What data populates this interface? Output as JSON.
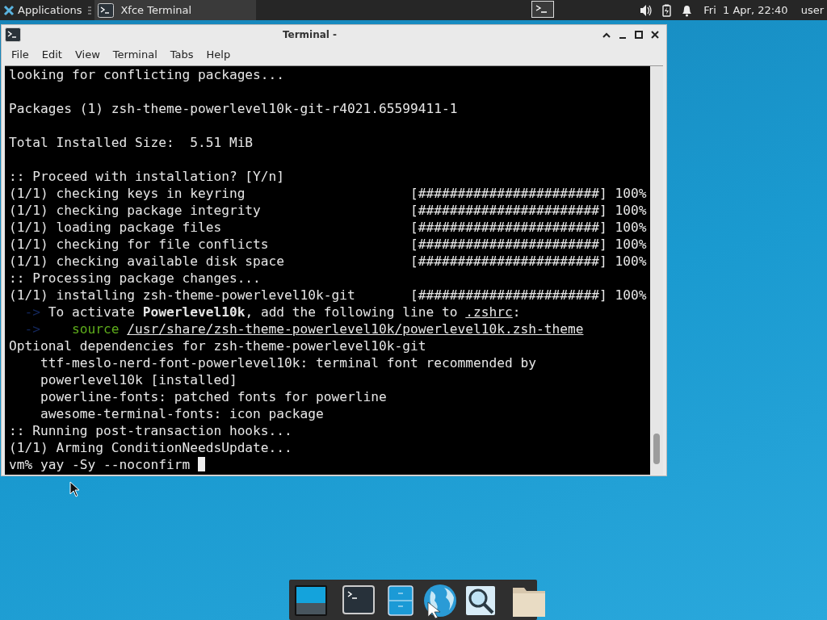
{
  "top_panel": {
    "applications": "Applications",
    "tasks": [
      {
        "label": "Xfce Terminal",
        "selected": true
      }
    ],
    "clock": "Fri  1 Apr, 22:40",
    "user": "user"
  },
  "window": {
    "title": "Terminal -",
    "menu": [
      "File",
      "Edit",
      "View",
      "Terminal",
      "Tabs",
      "Help"
    ],
    "lines": [
      {
        "segments": [
          {
            "kind": "plain",
            "text": "looking for conflicting packages..."
          }
        ]
      },
      {
        "blank_before": true,
        "segments": [
          {
            "kind": "plain",
            "text": "Packages (1) zsh-theme-powerlevel10k-git-r4021.65599411-1"
          }
        ]
      },
      {
        "blank_before": true,
        "segments": [
          {
            "kind": "plain",
            "text": "Total Installed Size:  5.51 MiB"
          }
        ]
      },
      {
        "blank_before": true,
        "segments": [
          {
            "kind": "plain",
            "text": ":: Proceed with installation? [Y/n]"
          }
        ]
      },
      {
        "segments": [
          {
            "kind": "plain",
            "text": "(1/1) checking keys in keyring                     [#######################] 100%"
          }
        ]
      },
      {
        "segments": [
          {
            "kind": "plain",
            "text": "(1/1) checking package integrity                   [#######################] 100%"
          }
        ]
      },
      {
        "segments": [
          {
            "kind": "plain",
            "text": "(1/1) loading package files                        [#######################] 100%"
          }
        ]
      },
      {
        "segments": [
          {
            "kind": "plain",
            "text": "(1/1) checking for file conflicts                  [#######################] 100%"
          }
        ]
      },
      {
        "segments": [
          {
            "kind": "plain",
            "text": "(1/1) checking available disk space                [#######################] 100%"
          }
        ]
      },
      {
        "segments": [
          {
            "kind": "plain",
            "text": ":: Processing package changes..."
          }
        ]
      },
      {
        "segments": [
          {
            "kind": "plain",
            "text": "(1/1) installing zsh-theme-powerlevel10k-git       [#######################] 100%"
          }
        ]
      },
      {
        "segments": [
          {
            "kind": "arrow",
            "text": "  ->"
          },
          {
            "kind": "plain",
            "text": " To activate "
          },
          {
            "kind": "bold",
            "text": "Powerlevel10k"
          },
          {
            "kind": "plain",
            "text": ", add the following line to "
          },
          {
            "kind": "underline",
            "text": ".zshrc"
          },
          {
            "kind": "plain",
            "text": ":"
          }
        ]
      },
      {
        "segments": [
          {
            "kind": "arrow",
            "text": "  ->"
          },
          {
            "kind": "green",
            "text": "    source "
          },
          {
            "kind": "underline",
            "text": "/usr/share/zsh-theme-powerlevel10k/powerlevel10k.zsh-theme"
          }
        ]
      },
      {
        "segments": [
          {
            "kind": "plain",
            "text": "Optional dependencies for zsh-theme-powerlevel10k-git"
          }
        ]
      },
      {
        "segments": [
          {
            "kind": "plain",
            "text": "    ttf-meslo-nerd-font-powerlevel10k: terminal font recommended by"
          }
        ]
      },
      {
        "segments": [
          {
            "kind": "plain",
            "text": "    powerlevel10k [installed]"
          }
        ]
      },
      {
        "segments": [
          {
            "kind": "plain",
            "text": "    powerline-fonts: patched fonts for powerline"
          }
        ]
      },
      {
        "segments": [
          {
            "kind": "plain",
            "text": "    awesome-terminal-fonts: icon package"
          }
        ]
      },
      {
        "segments": [
          {
            "kind": "plain",
            "text": ":: Running post-transaction hooks..."
          }
        ]
      },
      {
        "segments": [
          {
            "kind": "plain",
            "text": "(1/1) Arming ConditionNeedsUpdate..."
          }
        ]
      },
      {
        "segments": [
          {
            "kind": "plain",
            "text": "vm% yay -Sy --noconfirm "
          }
        ],
        "cursor": true
      }
    ]
  }
}
